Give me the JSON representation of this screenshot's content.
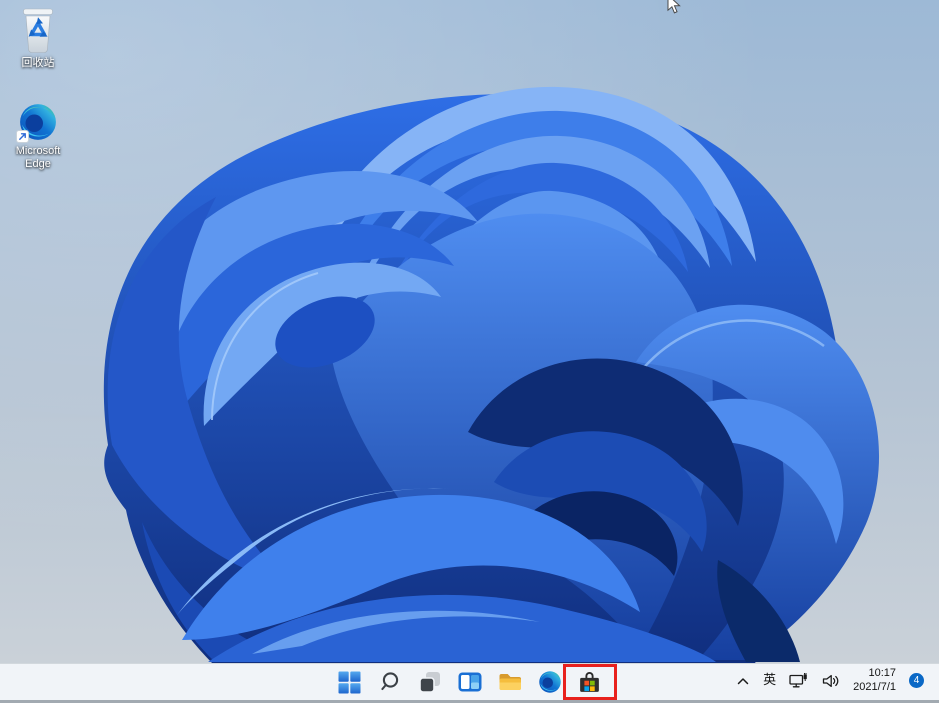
{
  "desktop": {
    "icons": [
      {
        "name": "recycle-bin",
        "label": "回收站"
      },
      {
        "name": "microsoft-edge",
        "label_line1": "Microsoft",
        "label_line2": "Edge"
      }
    ]
  },
  "taskbar": {
    "buttons": [
      {
        "name": "start",
        "icon": "windows-start-icon"
      },
      {
        "name": "search",
        "icon": "search-icon"
      },
      {
        "name": "task-view",
        "icon": "task-view-icon"
      },
      {
        "name": "widgets",
        "icon": "widgets-icon"
      },
      {
        "name": "file-explorer",
        "icon": "folder-icon"
      },
      {
        "name": "edge",
        "icon": "edge-icon"
      },
      {
        "name": "microsoft-store",
        "icon": "store-icon",
        "highlighted": true
      }
    ],
    "tray": {
      "ime": "英",
      "icons": [
        "chevron-up-icon",
        "network-icon",
        "volume-icon"
      ],
      "clock": {
        "time": "10:17",
        "date": "2021/7/1"
      },
      "badge": {
        "count": "4"
      }
    }
  },
  "annotation": {
    "type": "highlight-box",
    "target": "microsoft-store",
    "color": "#e8211d"
  },
  "colors": {
    "taskbar_bg": "#f1f4f8",
    "badge_blue": "#0a68c6",
    "annotation_red": "#e8211d",
    "wallpaper_blue": "#2e6ee6"
  }
}
